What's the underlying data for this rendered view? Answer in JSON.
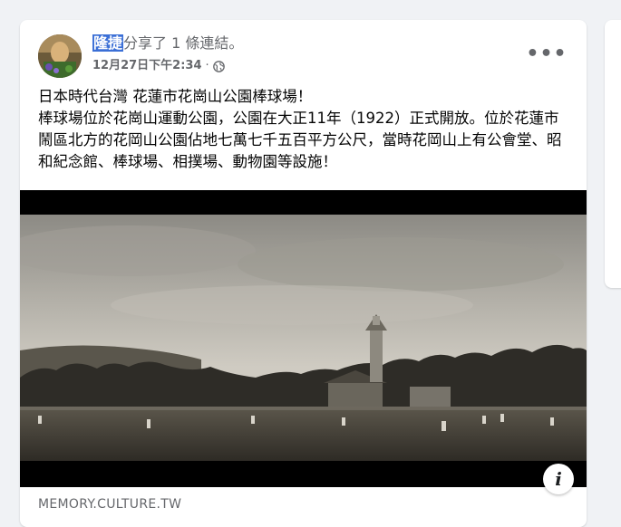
{
  "post": {
    "author": "隆捷",
    "action": "分享了 1 條連結。",
    "timestamp": "12月27日下午2:34",
    "separator": "·",
    "privacy_icon": "globe-icon",
    "more_icon": "more-dots-icon",
    "text_lines": [
      "日本時代台灣 花蓮市花崗山公園棒球場！",
      "棒球場位於花崗山運動公園，公園在大正11年（1922）正式開放。位於花蓮市鬧區北方的花岡山公園佔地七萬七千五百平方公尺，當時花岡山上有公會堂、昭和紀念館、棒球場、相撲場、動物園等設施！"
    ]
  },
  "link": {
    "domain": "MEMORY.CULTURE.TW",
    "info_icon": "info-icon",
    "info_glyph": "i"
  },
  "colors": {
    "page_background": "#f0f2f5",
    "card_background": "#ffffff",
    "name_highlight": "#3b6fd6",
    "secondary_text": "#65676b",
    "primary_text": "#050505"
  }
}
